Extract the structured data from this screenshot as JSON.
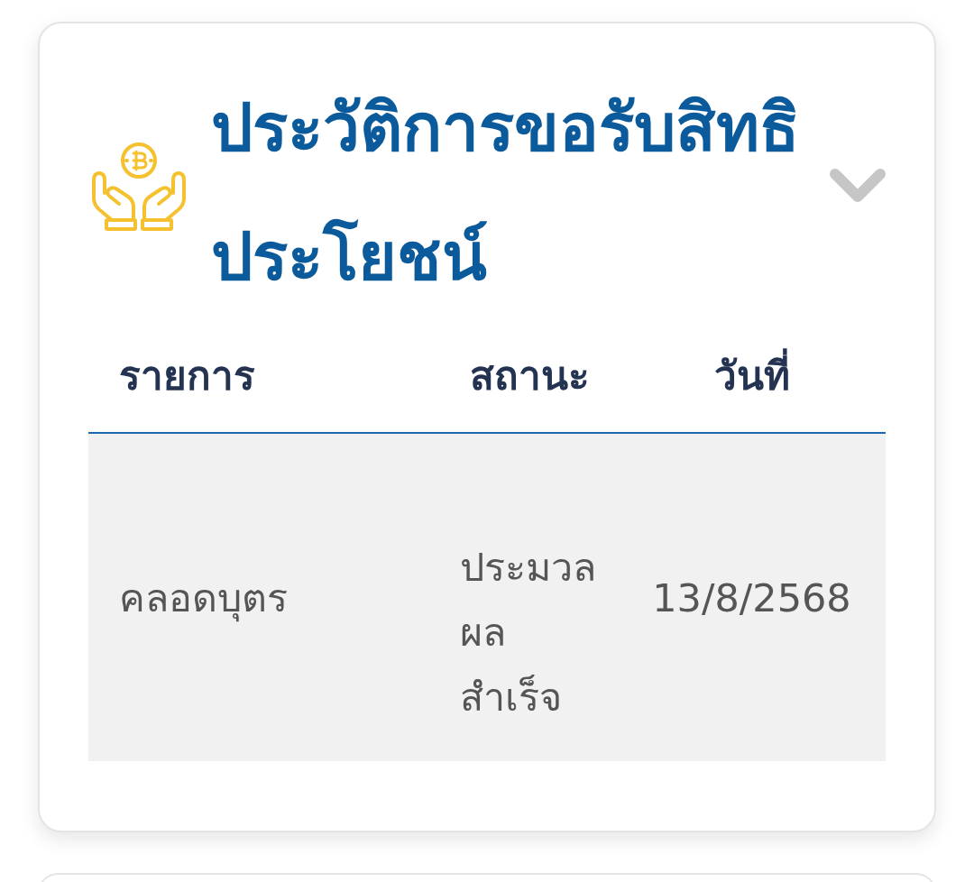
{
  "card": {
    "title": "ประวัติการขอรับสิทธิประโยชน์",
    "table": {
      "columns": [
        "รายการ",
        "สถานะ",
        "วันที่"
      ],
      "rows": [
        {
          "item": "คลอดบุตร",
          "status": "ประมวลผลสำเร็จ",
          "date": "13/8/2568"
        }
      ]
    }
  }
}
